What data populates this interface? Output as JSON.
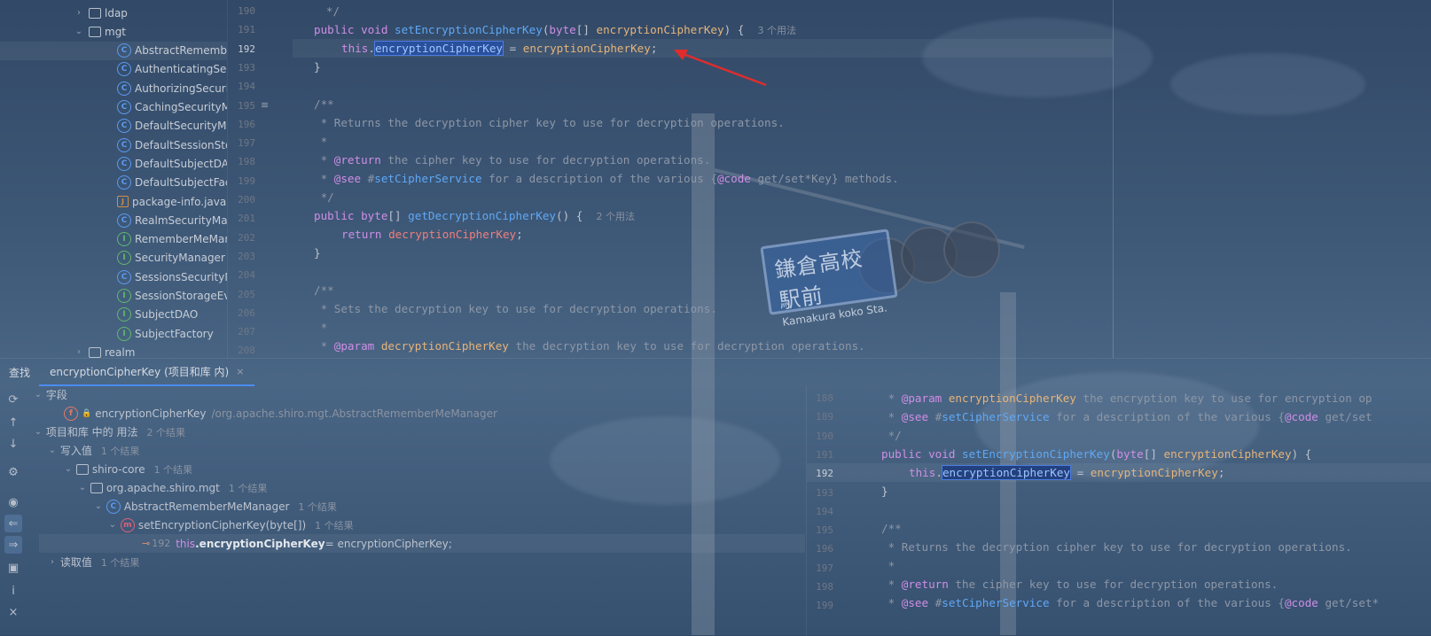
{
  "tree": {
    "items": [
      {
        "label": "ldap",
        "kind": "folder",
        "indent": 1,
        "chevron": "›"
      },
      {
        "label": "mgt",
        "kind": "folder",
        "indent": 1,
        "chevron": "⌄"
      },
      {
        "label": "AbstractRememberMeManager",
        "kind": "class",
        "indent": 2
      },
      {
        "label": "AuthenticatingSecurityManager",
        "kind": "class",
        "indent": 2
      },
      {
        "label": "AuthorizingSecurityManager",
        "kind": "class",
        "indent": 2
      },
      {
        "label": "CachingSecurityManager",
        "kind": "class",
        "indent": 2
      },
      {
        "label": "DefaultSecurityManager",
        "kind": "class",
        "indent": 2
      },
      {
        "label": "DefaultSessionStorageEvaluator",
        "kind": "class",
        "indent": 2
      },
      {
        "label": "DefaultSubjectDAO",
        "kind": "class",
        "indent": 2
      },
      {
        "label": "DefaultSubjectFactory",
        "kind": "class",
        "indent": 2
      },
      {
        "label": "package-info.java",
        "kind": "java",
        "indent": 2
      },
      {
        "label": "RealmSecurityManager",
        "kind": "class",
        "indent": 2
      },
      {
        "label": "RememberMeManager",
        "kind": "interface",
        "indent": 2
      },
      {
        "label": "SecurityManager",
        "kind": "interface",
        "indent": 2
      },
      {
        "label": "SessionsSecurityManager",
        "kind": "class",
        "indent": 2
      },
      {
        "label": "SessionStorageEvaluator",
        "kind": "interface",
        "indent": 2
      },
      {
        "label": "SubjectDAO",
        "kind": "interface",
        "indent": 2
      },
      {
        "label": "SubjectFactory",
        "kind": "interface",
        "indent": 2
      },
      {
        "label": "realm",
        "kind": "folder",
        "indent": 1,
        "chevron": "›"
      }
    ]
  },
  "editor": {
    "line_numbers": [
      "190",
      "191",
      "192",
      "193",
      "194",
      "195",
      "196",
      "197",
      "198",
      "199",
      "200",
      "201",
      "202",
      "203",
      "204",
      "205",
      "206",
      "207",
      "208"
    ],
    "code": {
      "l190": "     */",
      "l191_kw": "public void ",
      "l191_fn": "setEncryptionCipherKey",
      "l191_a": "(",
      "l191_t": "byte",
      "l191_b": "[] ",
      "l191_p": "encryptionCipherKey",
      "l191_c": ") {",
      "l191_hint": "3 个用法",
      "l192_kw": "this",
      "l192_dot": ".",
      "l192_fld": "encryptionCipherKey",
      "l192_eq": " = ",
      "l192_p": "encryptionCipherKey",
      "l192_end": ";",
      "l193": "}",
      "l195": "/**",
      "l196": " * Returns the decryption cipher key to use for decryption operations.",
      "l197": " *",
      "l198_a": " * ",
      "l198_tag": "@return",
      "l198_b": " the cipher key to use for decryption operations.",
      "l199_a": " * ",
      "l199_tag": "@see",
      "l199_b": " #",
      "l199_link": "setCipherService",
      "l199_c": " for a description of the various {",
      "l199_code": "@code",
      "l199_d": " get/set*Key} methods.",
      "l200": " */",
      "l201_kw": "public ",
      "l201_t": "byte",
      "l201_b": "[] ",
      "l201_fn": "getDecryptionCipherKey",
      "l201_c": "() {",
      "l201_hint": "2 个用法",
      "l202_kw": "return ",
      "l202_fld": "decryptionCipherKey",
      "l202_end": ";",
      "l203": "}",
      "l205": "/**",
      "l206": " * Sets the decryption key to use for decryption operations.",
      "l207": " *",
      "l208_a": " * ",
      "l208_tag": "@param",
      "l208_p": " decryptionCipherKey",
      "l208_b": " the decryption key to use for decryption operations."
    }
  },
  "find": {
    "tab_find": "查找",
    "tab_query": "encryptionCipherKey (项目和库 内)",
    "tab_close": "×",
    "results": {
      "fields_label": "字段",
      "field_name": "encryptionCipherKey",
      "field_path": "/org.apache.shiro.mgt.AbstractRememberMeManager",
      "usages_label": "项目和库 中的 用法",
      "usages_count": "2 个结果",
      "write_label": "写入值",
      "write_count": "1 个结果",
      "module": "shiro-core",
      "module_count": "1 个结果",
      "package": "org.apache.shiro.mgt",
      "package_count": "1 个结果",
      "class": "AbstractRememberMeManager",
      "class_count": "1 个结果",
      "method": "setEncryptionCipherKey(byte[])",
      "method_count": "1 个结果",
      "usage_line": "192",
      "usage_kw": "this",
      "usage_code_bold": ".encryptionCipherKey",
      "usage_code_rest": " = encryptionCipherKey;",
      "read_label": "读取值",
      "read_count": "1 个结果"
    },
    "preview": {
      "line_numbers": [
        "188",
        "189",
        "190",
        "191",
        "192",
        "193",
        "194",
        "195",
        "196",
        "197",
        "198",
        "199"
      ],
      "l188_a": " * ",
      "l188_tag": "@param",
      "l188_p": " encryptionCipherKey",
      "l188_b": " the encryption key to use for encryption op",
      "l189_a": " * ",
      "l189_tag": "@see",
      "l189_b": " #",
      "l189_link": "setCipherService",
      "l189_c": " for a description of the various {",
      "l189_code": "@code",
      "l189_d": " get/set",
      "l190": " */",
      "l191_kw": "public void ",
      "l191_fn": "setEncryptionCipherKey",
      "l191_a": "(",
      "l191_t": "byte",
      "l191_b": "[] ",
      "l191_p": "encryptionCipherKey",
      "l191_c": ") {",
      "l192_kw": "this",
      "l192_dot": ".",
      "l192_fld": "encryptionCipherKey",
      "l192_eq": " = ",
      "l192_p": "encryptionCipherKey",
      "l192_end": ";",
      "l193": "}",
      "l195": "/**",
      "l196": " * Returns the decryption cipher key to use for decryption operations.",
      "l197": " *",
      "l198_a": " * ",
      "l198_tag": "@return",
      "l198_b": " the cipher key to use for decryption operations.",
      "l199_a": " * ",
      "l199_tag": "@see",
      "l199_b": " #",
      "l199_link": "setCipherService",
      "l199_c": " for a description of the various {",
      "l199_code": "@code",
      "l199_d": " get/set*"
    }
  },
  "background": {
    "sign_jp": "鎌倉高校駅前",
    "sign_en": "Kamakura koko Sta."
  },
  "colors": {
    "accent": "#4c8cf0",
    "annotation_arrow": "#e02c2c"
  }
}
